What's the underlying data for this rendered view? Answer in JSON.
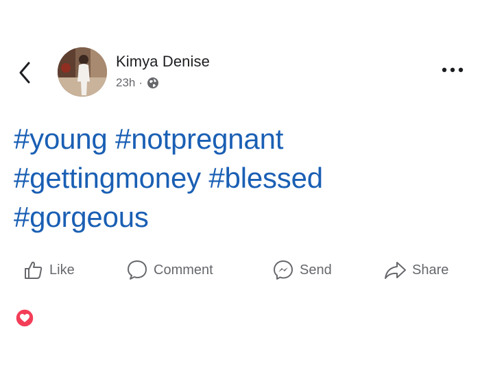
{
  "post": {
    "author": "Kimya Denise",
    "time": "23h",
    "separator": "·",
    "privacy_icon": "globe-icon",
    "text_line1": "#young #notpregnant",
    "text_line2": "#gettingmoney #blessed",
    "text_line3": "#gorgeous"
  },
  "actions": {
    "like": "Like",
    "comment": "Comment",
    "send": "Send",
    "share": "Share"
  },
  "icons": {
    "back": "chevron-left-icon",
    "more": "more-icon",
    "like": "thumbs-up-icon",
    "comment": "comment-bubble-icon",
    "send": "messenger-icon",
    "share": "share-arrow-icon",
    "reaction": "heart-reaction-icon"
  },
  "colors": {
    "hashtag": "#1e5fb8",
    "text_primary": "#1c1e21",
    "text_secondary": "#65676b",
    "reaction_love": "#f33e58"
  }
}
